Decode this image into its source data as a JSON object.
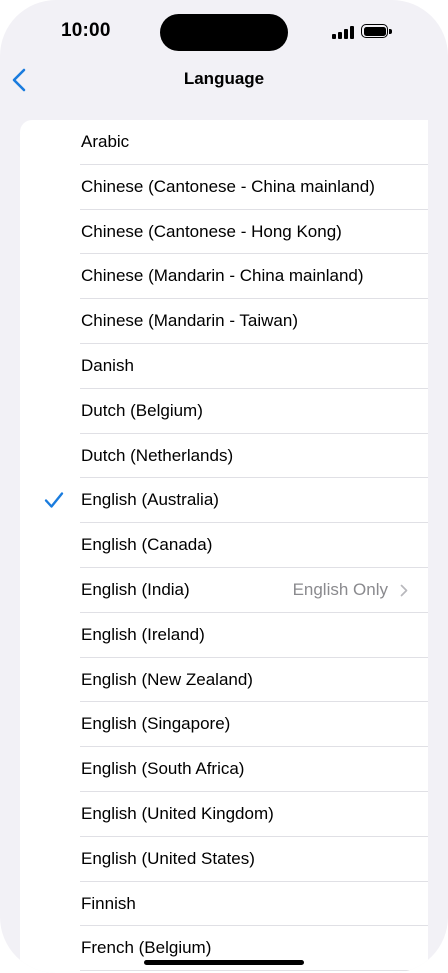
{
  "status_bar": {
    "time": "10:00"
  },
  "nav": {
    "title": "Language",
    "back_icon": "chevron-left-icon"
  },
  "colors": {
    "accent": "#1a7cde",
    "background": "#f2f1f6",
    "secondary_text": "#8a8a8e"
  },
  "languages": [
    {
      "label": "Arabic",
      "checked": false,
      "detail": ""
    },
    {
      "label": "Chinese (Cantonese - China mainland)",
      "checked": false,
      "detail": ""
    },
    {
      "label": "Chinese (Cantonese - Hong Kong)",
      "checked": false,
      "detail": ""
    },
    {
      "label": "Chinese (Mandarin - China mainland)",
      "checked": false,
      "detail": ""
    },
    {
      "label": "Chinese (Mandarin - Taiwan)",
      "checked": false,
      "detail": ""
    },
    {
      "label": "Danish",
      "checked": false,
      "detail": ""
    },
    {
      "label": "Dutch (Belgium)",
      "checked": false,
      "detail": ""
    },
    {
      "label": "Dutch (Netherlands)",
      "checked": false,
      "detail": ""
    },
    {
      "label": "English (Australia)",
      "checked": true,
      "detail": ""
    },
    {
      "label": "English (Canada)",
      "checked": false,
      "detail": ""
    },
    {
      "label": "English (India)",
      "checked": false,
      "detail": "English Only"
    },
    {
      "label": "English (Ireland)",
      "checked": false,
      "detail": ""
    },
    {
      "label": "English (New Zealand)",
      "checked": false,
      "detail": ""
    },
    {
      "label": "English (Singapore)",
      "checked": false,
      "detail": ""
    },
    {
      "label": "English (South Africa)",
      "checked": false,
      "detail": ""
    },
    {
      "label": "English (United Kingdom)",
      "checked": false,
      "detail": ""
    },
    {
      "label": "English (United States)",
      "checked": false,
      "detail": ""
    },
    {
      "label": "Finnish",
      "checked": false,
      "detail": ""
    },
    {
      "label": "French (Belgium)",
      "checked": false,
      "detail": ""
    }
  ]
}
